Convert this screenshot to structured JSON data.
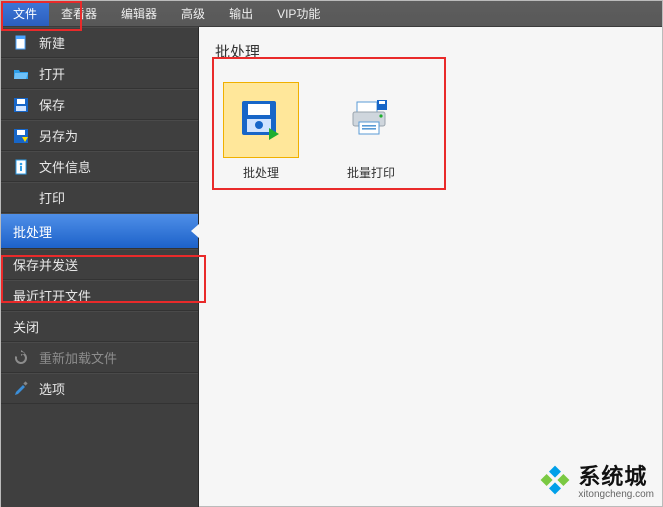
{
  "menubar": {
    "items": [
      {
        "label": "文件",
        "active": true
      },
      {
        "label": "查看器"
      },
      {
        "label": "编辑器"
      },
      {
        "label": "高级"
      },
      {
        "label": "输出"
      },
      {
        "label": "VIP功能"
      }
    ]
  },
  "sidebar": {
    "items": [
      {
        "label": "新建",
        "icon": "file-new-icon"
      },
      {
        "label": "打开",
        "icon": "folder-open-icon"
      },
      {
        "label": "保存",
        "icon": "save-icon"
      },
      {
        "label": "另存为",
        "icon": "save-as-icon"
      },
      {
        "label": "文件信息",
        "icon": "file-info-icon"
      },
      {
        "label": "打印",
        "icon": "print-icon"
      },
      {
        "label": "批处理",
        "icon": "",
        "selected": true
      },
      {
        "label": "保存并发送",
        "icon": ""
      },
      {
        "label": "最近打开文件",
        "icon": ""
      },
      {
        "label": "关闭",
        "icon": ""
      },
      {
        "label": "重新加载文件",
        "icon": "reload-icon",
        "disabled": true
      },
      {
        "label": "选项",
        "icon": "options-icon"
      }
    ]
  },
  "content": {
    "title": "批处理",
    "tiles": [
      {
        "label": "批处理",
        "icon": "batch-save-icon",
        "selected": true
      },
      {
        "label": "批量打印",
        "icon": "batch-print-icon"
      }
    ]
  },
  "watermark": {
    "title": "系统城",
    "subtitle": "xitongcheng.com"
  },
  "colors": {
    "highlight": "#e92a2a",
    "menu_active": "#2b5fbf",
    "tile_sel_bg": "#ffe79a"
  }
}
